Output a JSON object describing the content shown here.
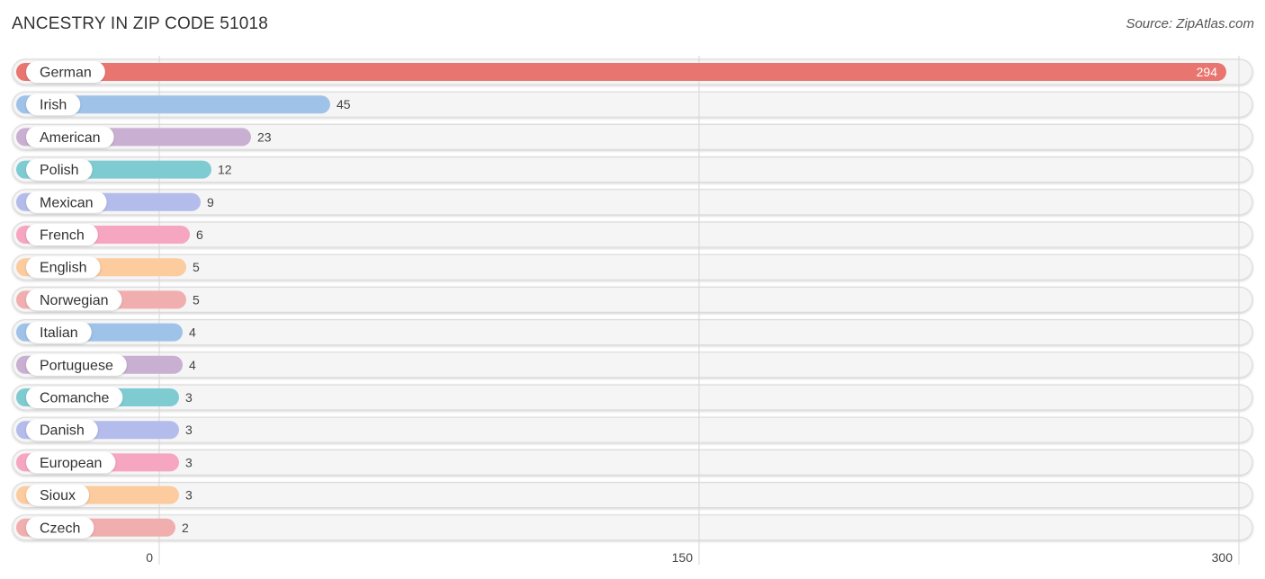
{
  "chart_data": {
    "type": "bar",
    "orientation": "horizontal",
    "title": "ANCESTRY IN ZIP CODE 51018",
    "source": "Source: ZipAtlas.com",
    "xlabel": "",
    "ylabel": "",
    "xlim": [
      0,
      300
    ],
    "xticks": [
      0,
      150,
      300
    ],
    "grid": true,
    "categories": [
      "German",
      "Irish",
      "American",
      "Polish",
      "Mexican",
      "French",
      "English",
      "Norwegian",
      "Italian",
      "Portuguese",
      "Comanche",
      "Danish",
      "European",
      "Sioux",
      "Czech"
    ],
    "values": [
      294,
      45,
      23,
      12,
      9,
      6,
      5,
      5,
      4,
      4,
      3,
      3,
      3,
      3,
      2
    ],
    "colors": [
      "#e8756f",
      "#9fc2e9",
      "#c9afd1",
      "#7ecbd2",
      "#b3bceb",
      "#f6a6c0",
      "#fccb9e",
      "#f1aeae",
      "#9fc2e9",
      "#c9afd1",
      "#7ecbd2",
      "#b3bceb",
      "#f6a6c0",
      "#fccb9e",
      "#f1aeae"
    ]
  }
}
